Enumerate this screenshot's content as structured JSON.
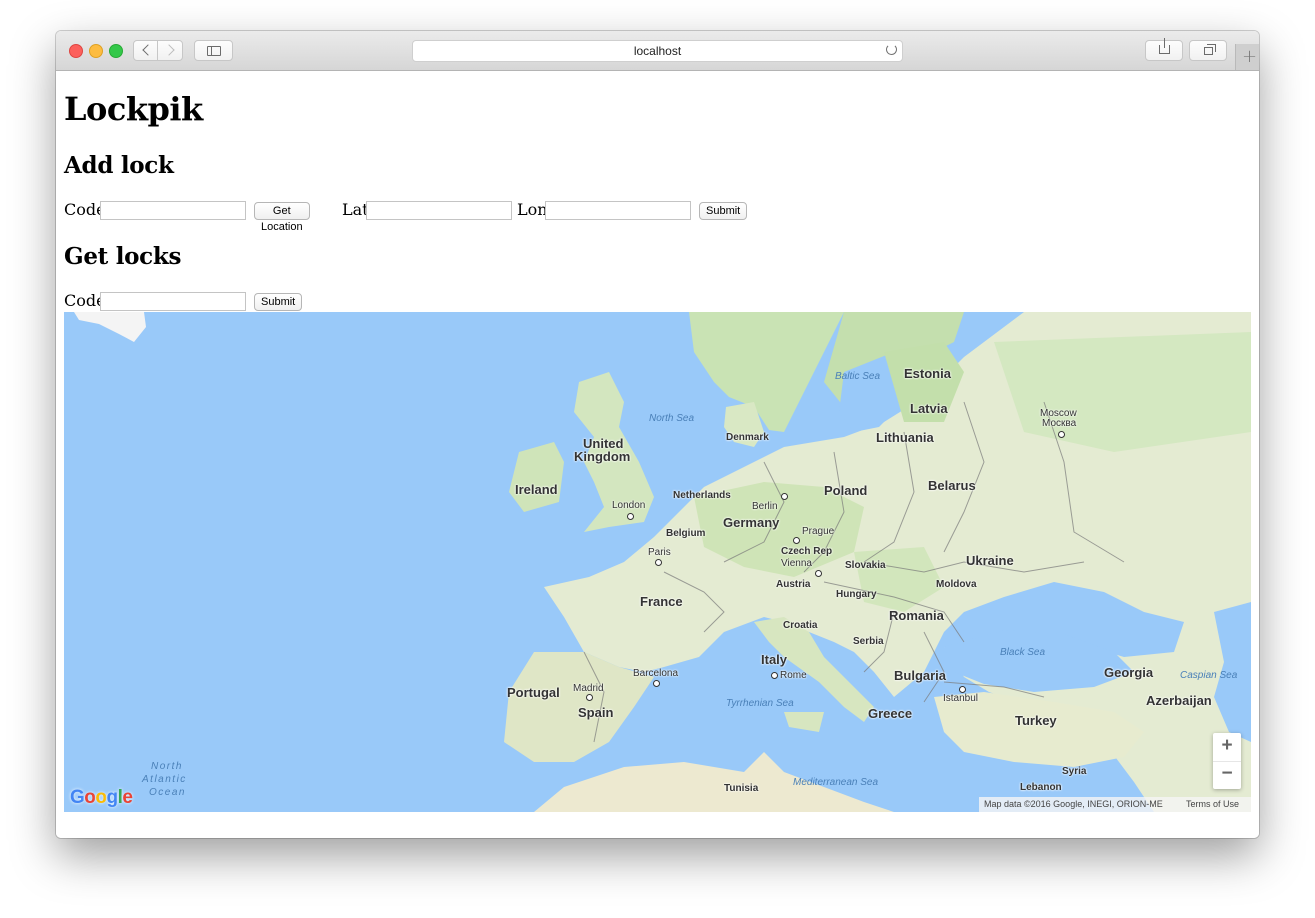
{
  "browser": {
    "url": "localhost"
  },
  "page": {
    "title": "Lockpik",
    "add_lock": {
      "heading": "Add lock",
      "code_label": "Code",
      "code_value": "",
      "get_location_label": "Get Location",
      "lat_label": "Lat",
      "lat_value": "",
      "lon_label": "Lon",
      "lon_value": "",
      "submit_label": "Submit"
    },
    "get_locks": {
      "heading": "Get locks",
      "code_label": "Code",
      "code_value": "",
      "submit_label": "Submit"
    }
  },
  "map": {
    "countries": [
      "Estonia",
      "Latvia",
      "Lithuania",
      "Denmark",
      "United",
      "Kingdom",
      "Ireland",
      "Netherlands",
      "Belgium",
      "Poland",
      "Belarus",
      "Germany",
      "Czech Rep",
      "Slovakia",
      "Austria",
      "Hungary",
      "Ukraine",
      "Moldova",
      "France",
      "Romania",
      "Croatia",
      "Serbia",
      "Italy",
      "Bulgaria",
      "Portugal",
      "Spain",
      "Greece",
      "Turkey",
      "Georgia",
      "Azerbaijan",
      "Tunisia",
      "Syria",
      "Lebanon"
    ],
    "cities": [
      "Moscow",
      "Москва",
      "London",
      "Berlin",
      "Prague",
      "Vienna",
      "Paris",
      "Barcelona",
      "Madrid",
      "Rome",
      "Istanbul"
    ],
    "seas": [
      "Baltic Sea",
      "North Sea",
      "Black Sea",
      "Caspian Sea",
      "Tyrrhenian Sea",
      "Mediterranean Sea",
      "North",
      "Atlantic",
      "Ocean"
    ],
    "zoom_in": "+",
    "zoom_out": "−",
    "attribution": "Map data ©2016 Google, INEGI, ORION-ME",
    "terms": "Terms of Use",
    "logo": "Google",
    "colors": {
      "water": "#99c9f9",
      "land": "#e8ecd5",
      "forest": "#c4e0b0"
    }
  }
}
